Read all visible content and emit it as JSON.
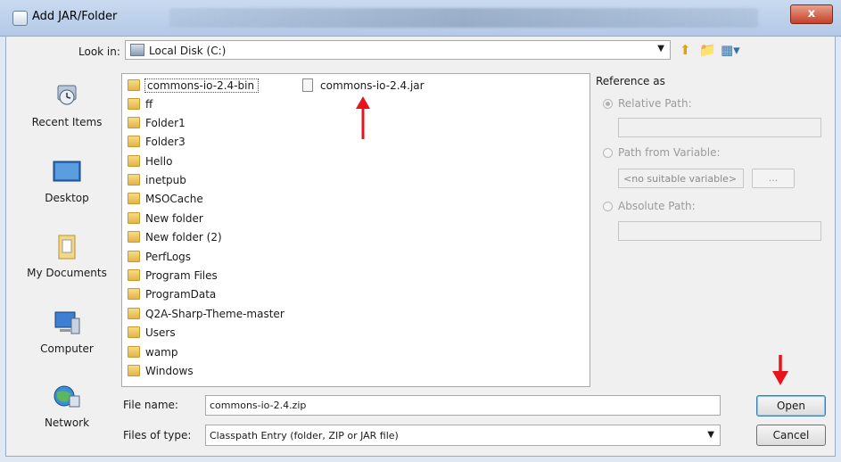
{
  "window": {
    "title": "Add JAR/Folder",
    "close_label": "x"
  },
  "lookin": {
    "label": "Look in:",
    "value": "Local Disk (C:)"
  },
  "places": [
    {
      "label": "Recent Items",
      "icon": "recent-items-icon"
    },
    {
      "label": "Desktop",
      "icon": "desktop-icon"
    },
    {
      "label": "My Documents",
      "icon": "my-documents-icon"
    },
    {
      "label": "Computer",
      "icon": "computer-icon"
    },
    {
      "label": "Network",
      "icon": "network-icon"
    }
  ],
  "files": {
    "folders": [
      "commons-io-2.4-bin",
      "ff",
      "Folder1",
      "Folder3",
      "Hello",
      "inetpub",
      "MSOCache",
      "New folder",
      "New folder (2)",
      "PerfLogs",
      "Program Files",
      "ProgramData",
      "Q2A-Sharp-Theme-master",
      "Users",
      "wamp",
      "Windows"
    ],
    "jar": "commons-io-2.4.jar"
  },
  "reference": {
    "title": "Reference as",
    "relative": "Relative Path:",
    "variable": "Path from Variable:",
    "variable_combo": "<no suitable variable>",
    "variable_button": "...",
    "absolute": "Absolute Path:"
  },
  "filename": {
    "label": "File name:",
    "value": "commons-io-2.4.zip"
  },
  "filetype": {
    "label": "Files of type:",
    "value": "Classpath Entry (folder, ZIP or JAR file)"
  },
  "buttons": {
    "open": "Open",
    "cancel": "Cancel"
  },
  "colors": {
    "annotation_arrow": "#e8141b",
    "title_bar": "#c9daf0",
    "folder": "#f0c85a"
  }
}
